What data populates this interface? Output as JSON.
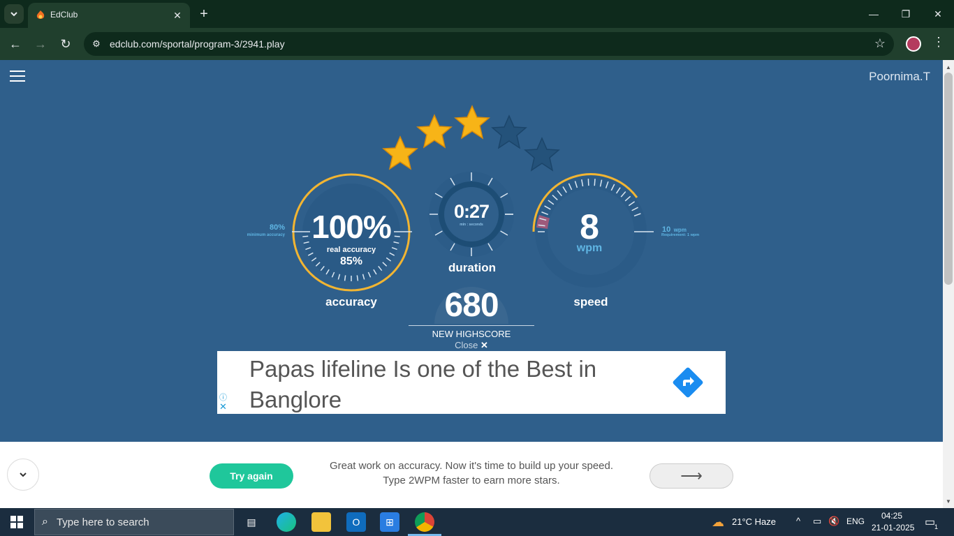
{
  "browser": {
    "tab_title": "EdClub",
    "url": "edclub.com/sportal/program-3/2941.play"
  },
  "header": {
    "username": "Poornima.T"
  },
  "results": {
    "stars_total": 5,
    "stars_earned": 3,
    "accuracy": {
      "value": "100%",
      "real_label": "real accuracy",
      "real_value": "85%",
      "label": "accuracy",
      "min_value": "80%",
      "min_label": "minimum accuracy"
    },
    "duration": {
      "value": "0:27",
      "unit": "min : seconds",
      "label": "duration"
    },
    "speed": {
      "value": "8",
      "unit": "wpm",
      "label": "speed",
      "req_value": "10",
      "req_unit": "wpm",
      "req_label": "Requirement: 1 wpm"
    },
    "score": {
      "value": "680",
      "label": "NEW HIGHSCORE",
      "close": "Close"
    }
  },
  "ad": {
    "text": "Papas lifeline Is one of the Best in Banglore"
  },
  "footer": {
    "try_again": "Try again",
    "message_line1": "Great work on accuracy. Now it's time to build up your speed.",
    "message_line2": "Type 2WPM faster to earn more stars.",
    "next_arrow": "⟶"
  },
  "taskbar": {
    "search_placeholder": "Type here to search",
    "weather": "21°C  Haze",
    "lang": "ENG",
    "time": "04:25",
    "date": "21-01-2025",
    "notification_count": "1"
  },
  "colors": {
    "page_bg": "#2f5f8b",
    "star_gold": "#f7b417",
    "accent_green": "#1fc79b",
    "gauge_yellow": "#f2b532"
  }
}
